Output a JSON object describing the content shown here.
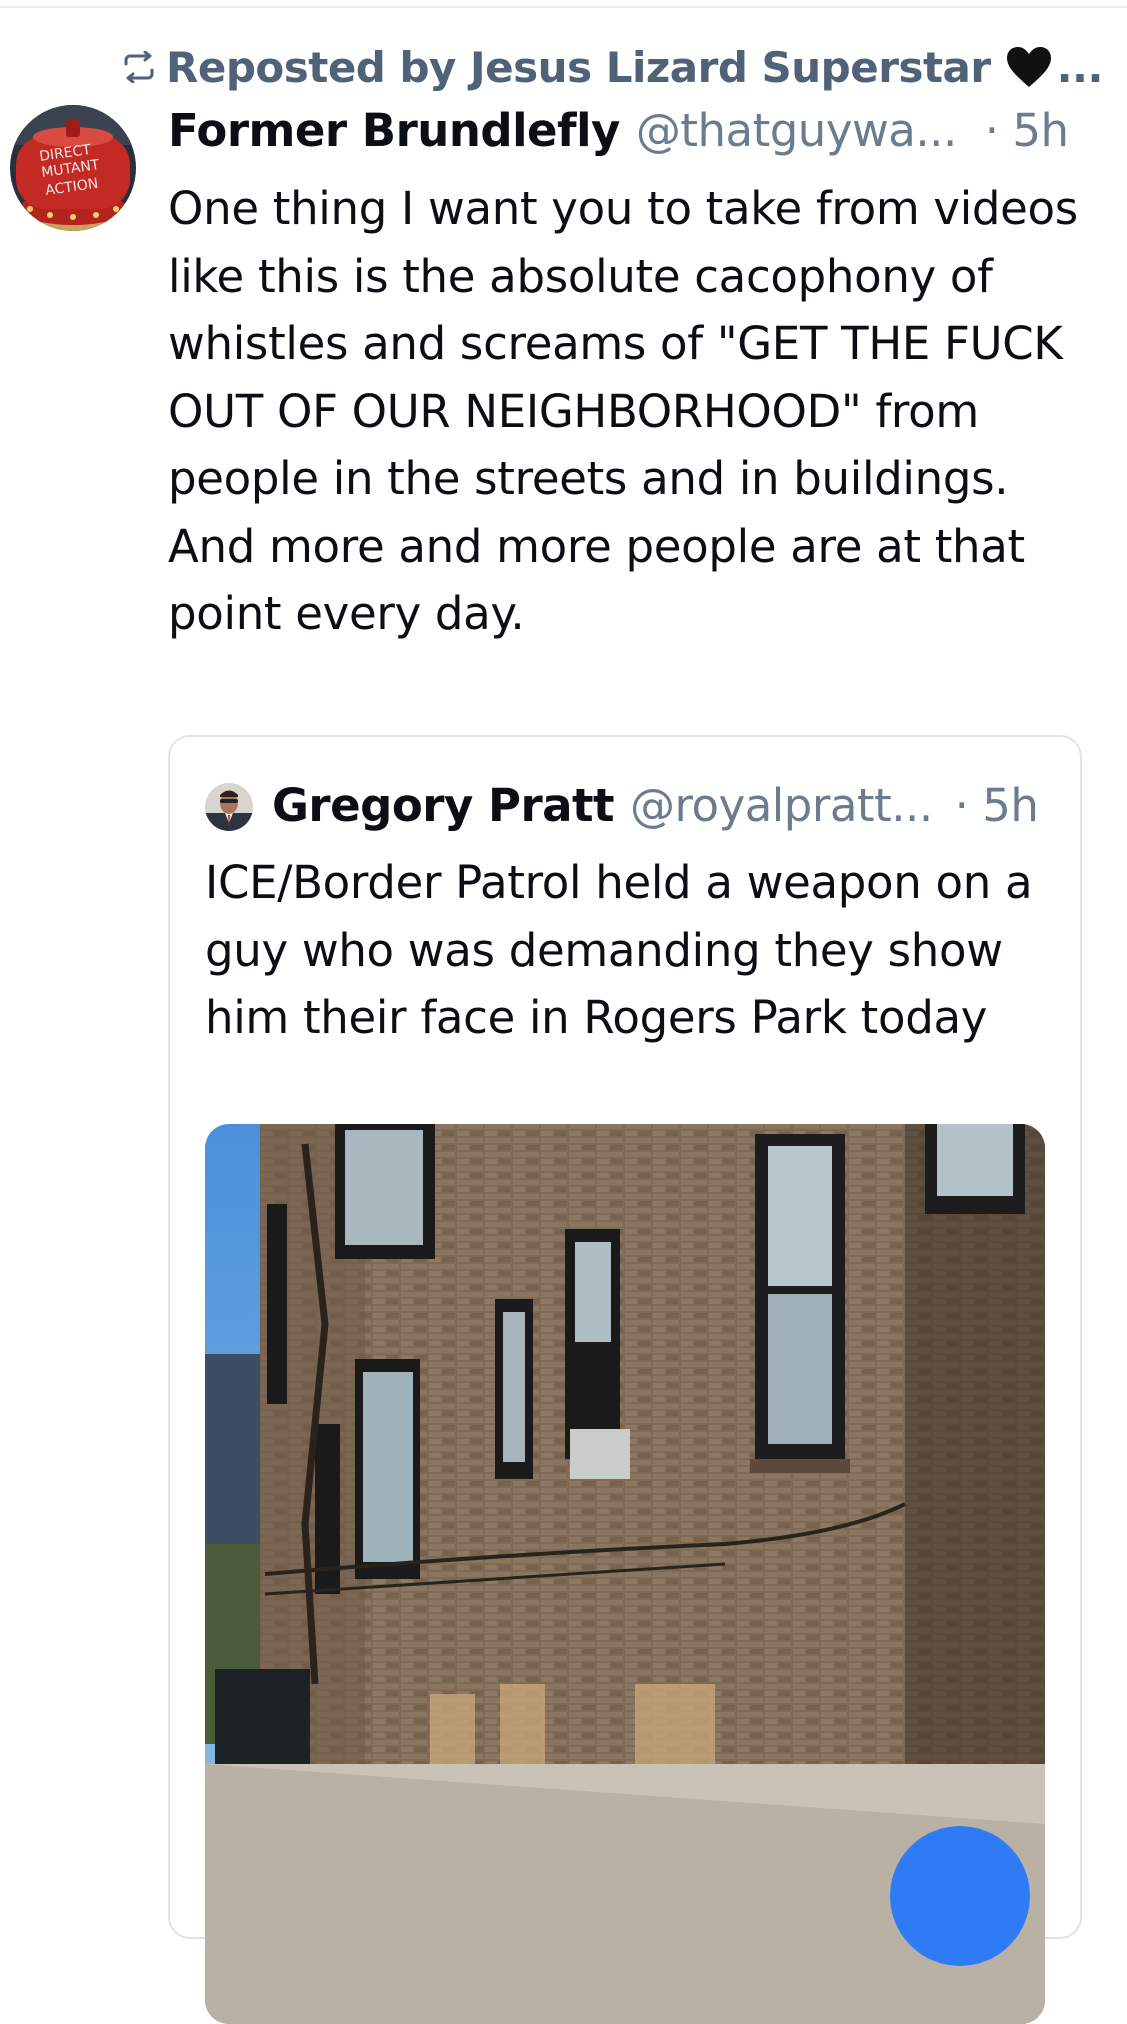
{
  "repost": {
    "label": "Reposted by Jesus Lizard Superstar",
    "more": "..."
  },
  "post": {
    "display_name": "Former Brundlefly",
    "handle": "@thatguywa...",
    "time": "· 5h",
    "avatar_text": [
      "DIRECT",
      "MUTANT",
      "ACTION"
    ],
    "text": "One thing I want you to take from videos like this is the absolute cacophony of whistles and screams of \"GET THE FUCK OUT OF OUR NEIGHBORHOOD\" from people in the streets and in buildings. And more and more people are at that point every day."
  },
  "quote": {
    "display_name": "Gregory Pratt",
    "handle": "@royalpratt...",
    "time": "· 5h",
    "text": "ICE/Border Patrol held a weapon on a guy who was demanding they show him their face in Rogers Park today"
  },
  "colors": {
    "muted": "#6b7c8f",
    "repost": "#4f6277",
    "accent": "#2f7bf5",
    "border": "#dfe4ea"
  }
}
